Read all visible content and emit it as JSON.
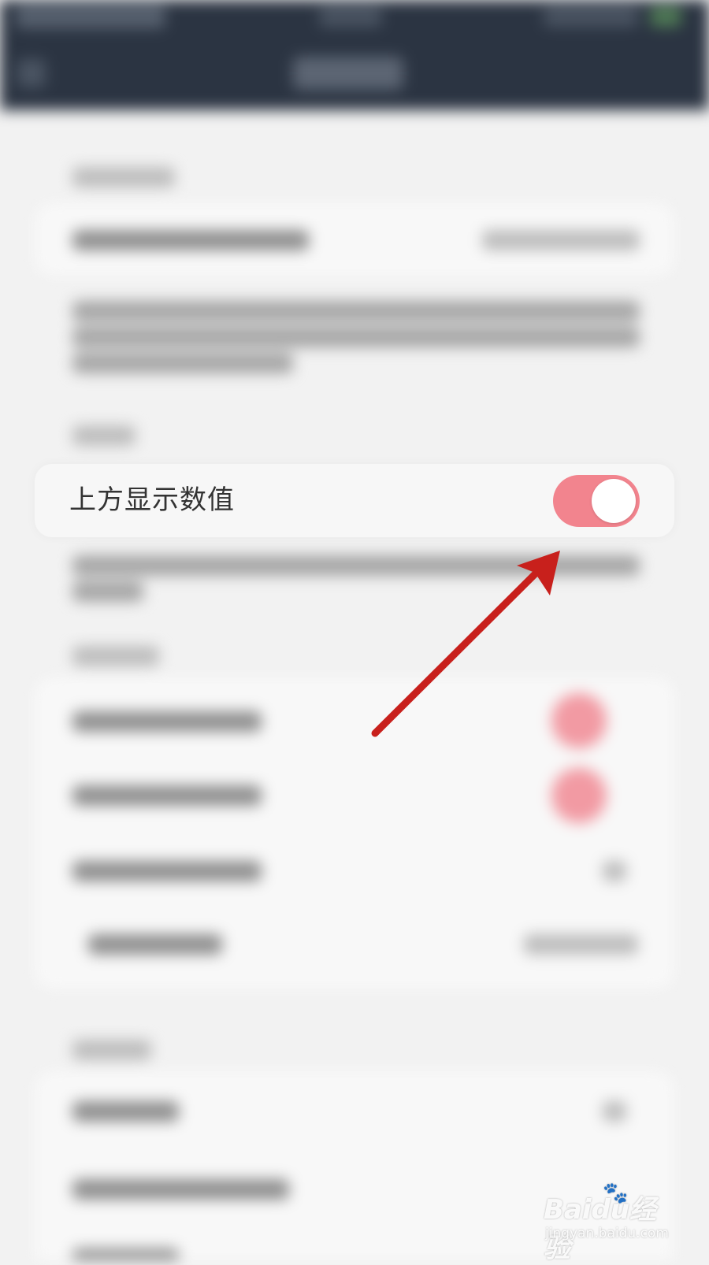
{
  "setting_row": {
    "label": "上方显示数值",
    "toggle_on": true
  },
  "colors": {
    "toggle_on": "#f2848e",
    "toggle_knob": "#ffffff",
    "arrow": "#c8201c",
    "header_bg": "#2b3442",
    "page_bg": "#f2f2f2"
  },
  "watermark": {
    "logo": "Baidu经验",
    "sub": "jingyan.baidu.com"
  }
}
